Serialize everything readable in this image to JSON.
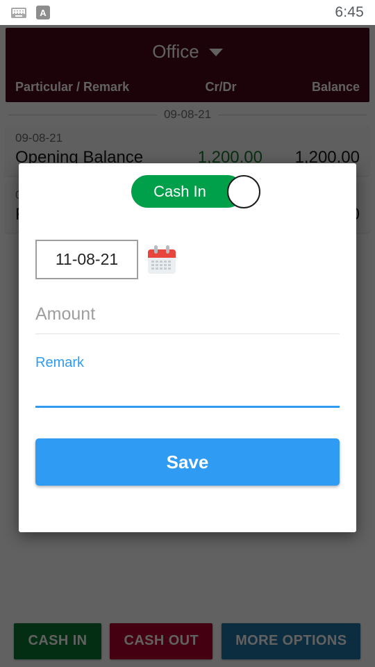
{
  "status_bar": {
    "time": "6:45",
    "keyboard_icon": "keyboard-icon",
    "input_method_icon": "A"
  },
  "app": {
    "title": "Office",
    "dropdown_icon": "chevron-down-icon",
    "columns": {
      "particular": "Particular / Remark",
      "crdr": "Cr/Dr",
      "balance": "Balance"
    },
    "date_separator": "09-08-21",
    "transactions": [
      {
        "date": "09-08-21",
        "name": "Opening Balance",
        "amount": "1,200.00",
        "type": "cr",
        "balance": "1,200.00"
      },
      {
        "date": "09-08-21",
        "name": "Payment",
        "amount": "",
        "type": "cr",
        "balance": "0"
      }
    ],
    "bottom_actions": {
      "cash_in": "CASH IN",
      "cash_out": "CASH OUT",
      "more_options": "MORE OPTIONS"
    }
  },
  "dialog": {
    "toggle_label": "Cash In",
    "date_value": "11-08-21",
    "calendar_icon": "calendar-icon",
    "amount_placeholder": "Amount",
    "amount_value": "",
    "remark_label": "Remark",
    "remark_value": "",
    "save_label": "Save"
  },
  "colors": {
    "appbar": "#4b0719",
    "toggle_green": "#00a04b",
    "accent_blue": "#2f9bf2",
    "credit_green": "#1a7a2e",
    "cash_in_btn": "#0a7a32",
    "cash_out_btn": "#b3002a",
    "more_options_btn": "#2176a8"
  }
}
